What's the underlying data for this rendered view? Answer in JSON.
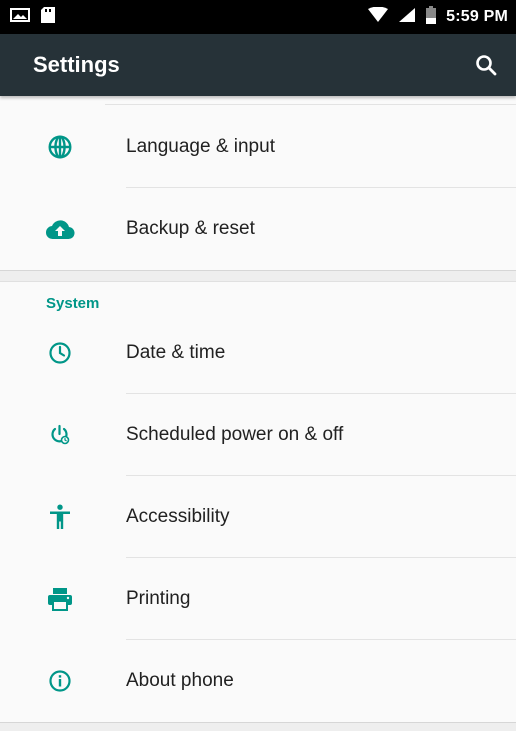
{
  "status_bar": {
    "time": "5:59 PM",
    "icons": [
      "image-notification-icon",
      "sd-card-icon",
      "wifi-icon",
      "cell-signal-icon",
      "battery-icon"
    ]
  },
  "app_bar": {
    "title": "Settings",
    "search_icon": "search-icon"
  },
  "colors": {
    "accent": "#009688",
    "app_bar": "#263238",
    "status_bar": "#000000",
    "text_primary": "#212121",
    "background": "#fafafa"
  },
  "personal_items": [
    {
      "label": "Language & input",
      "icon": "globe-icon"
    },
    {
      "label": "Backup & reset",
      "icon": "cloud-upload-icon"
    }
  ],
  "system": {
    "header": "System",
    "items": [
      {
        "label": "Date & time",
        "icon": "clock-icon"
      },
      {
        "label": "Scheduled power on & off",
        "icon": "scheduled-power-icon"
      },
      {
        "label": "Accessibility",
        "icon": "accessibility-icon"
      },
      {
        "label": "Printing",
        "icon": "printer-icon"
      },
      {
        "label": "About phone",
        "icon": "info-icon"
      }
    ]
  }
}
